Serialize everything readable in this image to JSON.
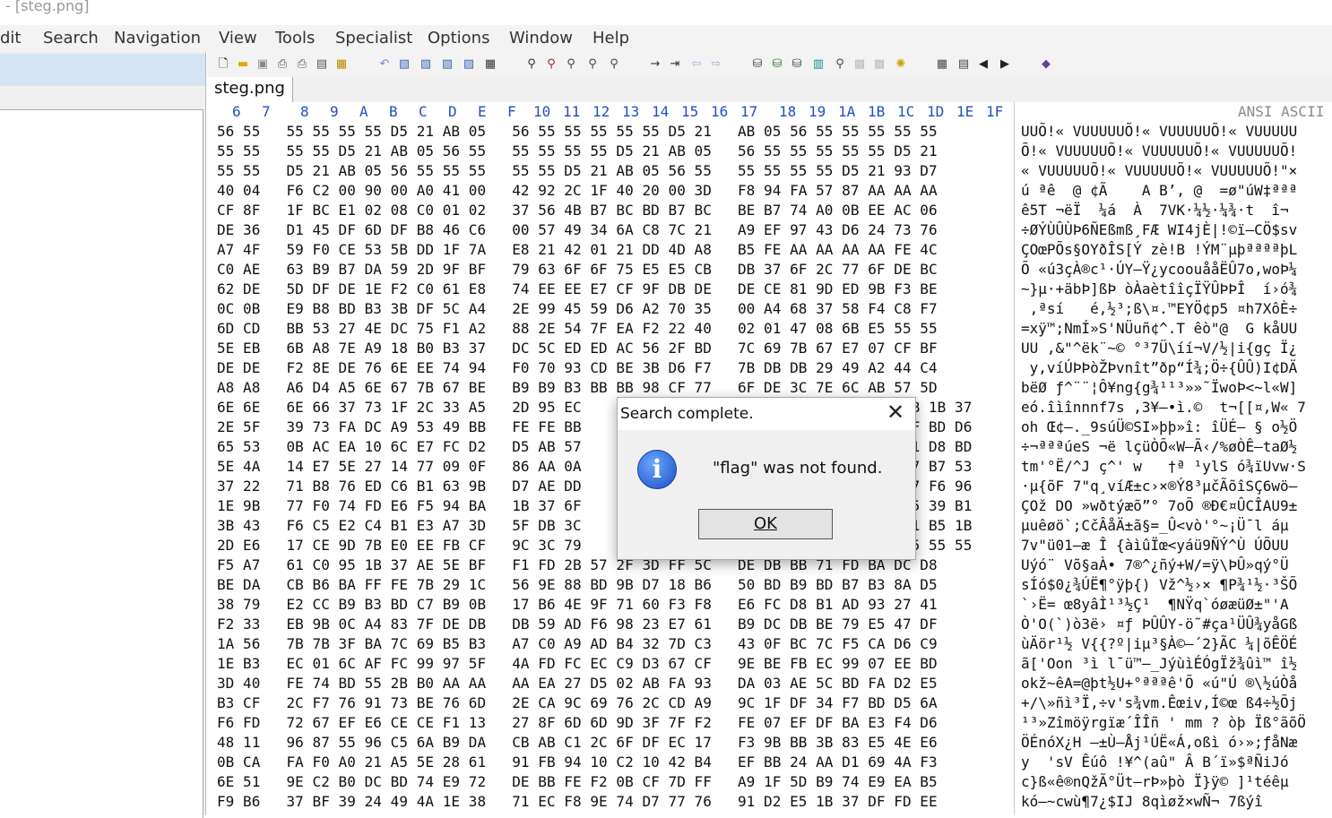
{
  "window": {
    "title": "- [steg.png]"
  },
  "menu": [
    "Edit",
    "Search",
    "Navigation",
    "View",
    "Tools",
    "Specialist",
    "Options",
    "Window",
    "Help"
  ],
  "menu_visible": [
    "dit",
    "Search",
    "Navigation",
    "View",
    "Tools",
    "Specialist",
    "Options",
    "Window",
    "Help"
  ],
  "tab": {
    "label": "steg.png"
  },
  "hex_header": {
    "columns": [
      "6",
      "7",
      "8",
      "9",
      "A",
      "B",
      "C",
      "D",
      "E",
      "F",
      "10",
      "11",
      "12",
      "13",
      "14",
      "15",
      "16",
      "17",
      "18",
      "19",
      "1A",
      "1B",
      "1C",
      "1D",
      "1E",
      "1F"
    ],
    "ascii_label": "ANSI ASCII"
  },
  "hex_rows": [
    "56 55   55 55 55 55 D5 21 AB 05   56 55 55 55 55 55 D5 21   AB 05 56 55 55 55 55 55",
    "55 55   55 55 D5 21 AB 05 56 55   55 55 55 55 D5 21 AB 05   56 55 55 55 55 55 D5 21",
    "55 55   D5 21 AB 05 56 55 55 55   55 55 D5 21 AB 05 56 55   55 55 55 55 D5 21 93 D7",
    "40 04   F6 C2 00 90 00 A0 41 00   42 92 2C 1F 40 20 00 3D   F8 94 FA 57 87 AA AA AA",
    "CF 8F   1F BC E1 02 08 C0 01 02   37 56 4B B7 BC BD B7 BC   BE B7 74 A0 0B EE AC 06",
    "DE 36   D1 45 DF 6D DF B8 46 C6   00 57 49 34 6A C8 7C 21   A9 EF 97 43 D6 24 73 76",
    "A7 4F   59 F0 CE 53 5B DD 1F 7A   E8 21 42 01 21 DD 4D A8   B5 FE AA AA AA AA FE 4C",
    "C0 AE   63 B9 B7 DA 59 2D 9F BF   79 63 6F 6F 75 E5 E5 CB   DB 37 6F 2C 77 6F DE BC",
    "62 DE   5D DF DE 1E F2 C0 61 E8   74 EE EE E7 CF 9F DB DE   DE CE 81 9D ED 9B F3 BE",
    "0C 0B   E9 B8 BD B3 3B DF 5C A4   2E 99 45 59 D6 A2 70 35   00 A4 68 37 58 F4 C8 F7",
    "6D CD   BB 53 27 4E DC 75 F1 A2   88 2E 54 7F EA F2 22 40   02 01 47 08 6B E5 55 55",
    "5E EB   6B A8 7E A9 18 B0 B3 37   DC 5C ED ED AC 56 2F BD   7C 69 7B 67 E7 07 CF BF",
    "DE DE   F2 8E DE 76 6E EE 74 94   F0 70 93 CD BE 3B D6 F7   7B DB DB 29 49 A2 44 C4",
    "A8 A8   A6 D4 A5 6E 67 7B 67 BE   B9 B9 B3 BB BB 98 CF 77   6F DE 3C 7E 6C AB 57 5D",
    "6E 6E   6E 66 37 73 1F 2C 33 A5   2D 95 EC                                     AB 1B 37",
    "2E 5F   39 73 FA DC A9 53 49 BB   FE FE BB                                     6F BD D6",
    "65 53   0B AC EA 10 6C E7 FC D2   D5 AB 57                                     61 D8 BD",
    "5E 4A   14 E7 5E 27 14 77 09 0F   86 AA 0A                                     77 B7 53",
    "37 22   71 B8 76 ED C6 B1 63 9B   D7 AE DD                                     77 F6 96",
    "1E 9B   77 F0 74 FD E6 F5 94 BA   1B 37 6F                                     55 39 B1",
    "3B 43   F6 C5 E2 C4 B1 E3 A7 3D   5F DB 3C                                     E1 B5 1B",
    "2D E6   17 CE 9D 7B E0 EE FB CF   9C 3C 79                                     55 55 55",
    "F5 A7   61 C0 95 1B 37 AE 5E BF   F1 FD 2B 57 2F 3D FF 5C   DE DB BB 71 FD BA DC D8",
    "BE DA   CB B6 BA FF FE 7B 29 1C   56 9E 88 BD 9B D7 18 B6   50 BD B9 BD B7 B3 8A D5",
    "38 79   E2 CC B9 B3 BD C7 B9 0B   17 B6 4E 9F 71 60 F3 F8   E6 FC D8 B1 AD 93 27 41",
    "F2 33   EB 9B 0C A4 83 7F DE DB   DB 59 AD F6 98 23 E7 61   B9 DC DB BE 79 E5 47 DF",
    "1A 56   7B 7B 3F BA 7C 69 B5 B3   A7 C0 A9 AD B4 32 7D C3   43 0F BC 7C F5 CA D6 C9",
    "1E B3   EC 01 6C AF FC 99 97 5F   4A FD FC EC C9 D3 67 CF   9E BE FB EC 99 07 EE BD",
    "3D 40   FE 74 BD 55 2B B0 AA AA   AA EA 27 D5 02 AB FA 93   DA 03 AE 5C BD FA D2 E5",
    "B3 CF   2C F7 76 91 73 BE 76 6D   2E CA 9C 69 76 2C CD A9   9C 1F DF 34 F7 BD D5 6A",
    "F6 FD   72 67 EF E6 CE CE F1 13   27 8F 6D 6D 9D 3F 7F F2   FE 07 EF DF BA E3 F4 D6",
    "48 11   96 87 55 96 C5 6A B9 DA   CB AB C1 2C 6F DF EC 17   F3 9B BB 3B 83 E5 4E E6",
    "0B CA   FA F0 A0 21 A5 5E 28 61   91 FB 94 10 C2 10 42 B4   EF BB 24 AA D1 69 4A F3",
    "6E 51   9E C2 B0 DC BD 74 E9 72   DE BB FE F2 0B CF 7D FF   A9 1F 5D B9 74 E9 EA B5",
    "F9 B6   37 BF 39 24 49 4A 1E 38   71 EC F8 9E 74 D7 77 76   91 D2 E5 1B 37 DF FD EE"
  ],
  "ascii_rows": [
    "UUÕ!« VUUUUUÕ!« VUUUUUÕ!« VUUUUU",
    "Õ!« VUUUUUÕ!« VUUUUUÕ!« VUUUUUÕ!",
    "« VUUUUUÕ!« VUUUUUÕ!« VUUUUUÕ!\"×",
    "ú ªê  @ ¢Ã    A B’, @  =ø\"úW‡ªªª",
    "ê5T ¬ëÏ  ¼á  À  7VK·¼½·¼¾·t  î¬",
    "÷ØÝÙÛÙÞ6ÑEßmß¸FÆ WI4jÈ|!©ï—CÖ$sv",
    "ÇOœPÕs§OYðÎS[Ý zè!B !ÝM¨µþªªªªþL",
    "Õ «ú3çÀ®c¹·ÚY–Ÿ¿ycoouååËÛ7o,woÞ¼",
    "~}µ·+äbÞ]ßÞ òÀaètîîçÏŸÛÞÞÎ  í›ó¾",
    " ,ªsí   é,½³;ß\\¤.™EYÖ¢p5 ¤h7XôÈ÷",
    "=xÿ™;NmÍ»S'NÜuñ¢^.T êò\"@  G kåUU",
    "UU ,&\"^ëk¨~© °³7Ü\\íí¬V/½|i{gç Ï¿",
    " y,víÚÞÞòŽÞvnît”ðp“Í¾;Ö÷{ÛÛ)I¢DÄ",
    "bëØ ƒ^¨¨¦Ô¥ng{g¾¹¹³»»˜ÏwoÞ<~l«W]",
    "eó.îìînnnf7s ,3¥–•ì.©  t¬[[¤,W« 7",
    "oh Œ¢–._9súÜ©SI»þþ»î: îÜÉ– § o½Ö",
    "÷¬ªªªúeS ¬ë lçüÒÕ«W–Ã‹/%øÒÊ–taØ½",
    "tm'°Ë/^J ç^' w   †ª ¹ylS ó¾ïUvw·S",
    "·µ{õF 7\"q¸víÆ±c›×®Ý8³µčÃõîSÇ6wö–",
    "ÇOž DO »wðtýæõ”° 7oÕ ®Ð€¤ÛCÎAU9±",
    "µuêøö`;CčÂåÄ±ã§=_Û<vò'°~¡Ü¯l áµ",
    "7v\"ü01–æ Î {àìûÏœ<yáü9ÑÝ^Ù ÚÕUU",
    "Uýó¨ Võ§aÀ• 7®^¿ñý+W/=ÿ\\ÞÛ»qý°Ü",
    "sÍó$0¿¾ÚË¶°ÿþ{) Vž^½›× ¶P¾¹½·³ŠÕ",
    "`›Ë= œ8yâÌ¹³½Ç¹  ¶NŸq`óøæüØ±\"'A",
    "Ò'O(`)ò3ë› ¤ƒ ÞÛÛY-ö˜#ça¹ÜÛ¾yåGß",
    "ùÄör¹½ V{{?º|iµ³§À©–´2}ÃC ¼|õÊÖÉ",
    "ã['Oon ³ì l¯ü™–_JýùìÉÓgÏž¾ûì™ î½",
    "okž~êA=@þt½U+°ªªªê'Õ «ú\"Ú ®\\½úÒå",
    "+/\\»ñì³Ï,÷v's¾vm.Êœiv,Í©œ ß4÷½Õj",
    "¹³»Zîmöÿrgïæ΄ÎÎñ ' mm ? òþ Ïß°ãõÖ",
    "ÖÉnóX¿H –±Ù–Åj¹ÚË«Á,oßì ó›»;ƒåNæ",
    "y  'sV Êúô !¥^(aû\" Â B´ï»$ªÑiJó",
    "c}ß«ê®nQžÃ°Üt–rÞ»þò Ï}ÿ© ]¹téêµ",
    "kó–~cwù¶7¿$IJ 8qìøž×wÑ¬ 7ßýî"
  ],
  "dialog": {
    "title": "Search complete.",
    "message": "\"flag\" was not found.",
    "ok_label": "OK"
  }
}
